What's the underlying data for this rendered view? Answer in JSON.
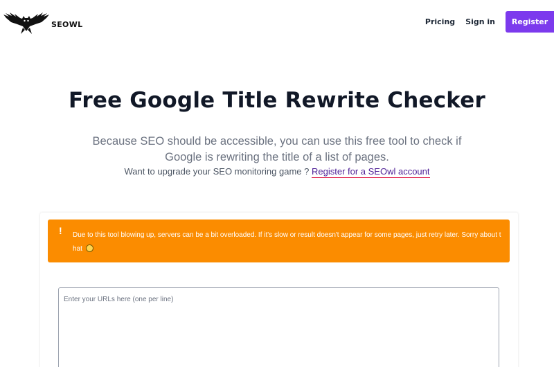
{
  "header": {
    "brand": "SEOWL",
    "nav": {
      "pricing": "Pricing",
      "signin": "Sign in",
      "register": "Register"
    }
  },
  "hero": {
    "title": "Free Google Title Rewrite Checker",
    "subtitle": "Because SEO should be accessible, you can use this free tool to check if Google is rewriting the title of a list of pages.",
    "cta_prefix": "Want to upgrade your SEO monitoring game ?",
    "cta_link": "Register for a SEOwl account"
  },
  "alert": {
    "icon": "!",
    "message": "Due to this tool blowing up, servers can be a bit overloaded. If it's slow or result doesn't appear for some pages, just retry later. Sorry about that",
    "emoji": "grinning-sweat-emoji"
  },
  "form": {
    "urls_placeholder": "Enter your URLs here (one per line)",
    "urls_value": ""
  },
  "colors": {
    "accent": "#7c3aed",
    "alert": "#fb8c00",
    "link_underline": "#e11d48"
  }
}
